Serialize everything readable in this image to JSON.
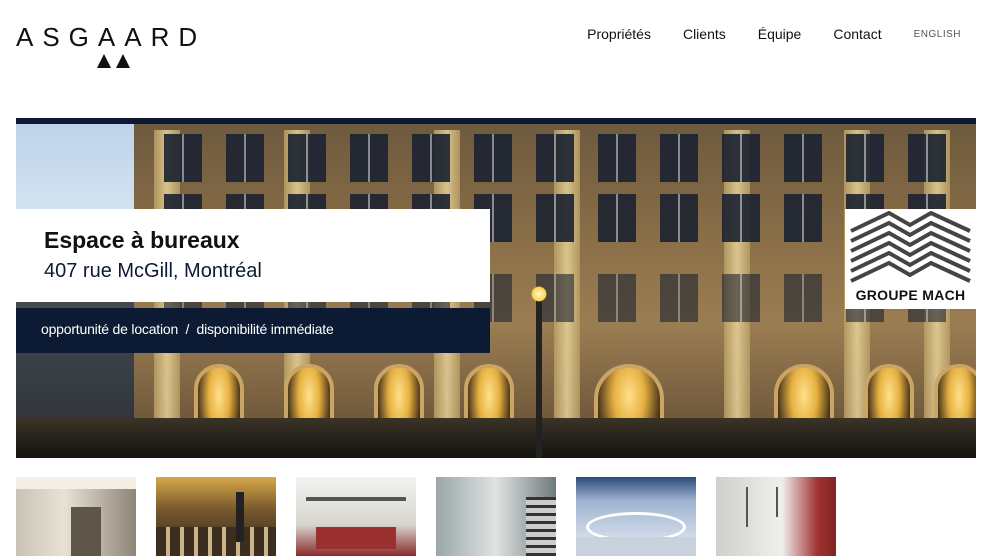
{
  "header": {
    "logo_text": "ASGAARD",
    "nav": [
      {
        "label": "Propriétés"
      },
      {
        "label": "Clients"
      },
      {
        "label": "Équipe"
      },
      {
        "label": "Contact"
      }
    ],
    "language_link": "ENGLISH"
  },
  "hero": {
    "title": "Espace à bureaux",
    "address": "407 rue McGill, Montréal",
    "tagline": "opportunité de location  /  disponibilité immédiate",
    "brand_logo_text": "GROUPE MACH",
    "accent_color": "#0d1a33"
  },
  "thumbnails": [
    {
      "name": "thumbnail-lobby"
    },
    {
      "name": "thumbnail-restaurant"
    },
    {
      "name": "thumbnail-office-space"
    },
    {
      "name": "thumbnail-atrium"
    },
    {
      "name": "thumbnail-reception"
    },
    {
      "name": "thumbnail-corridor"
    }
  ]
}
